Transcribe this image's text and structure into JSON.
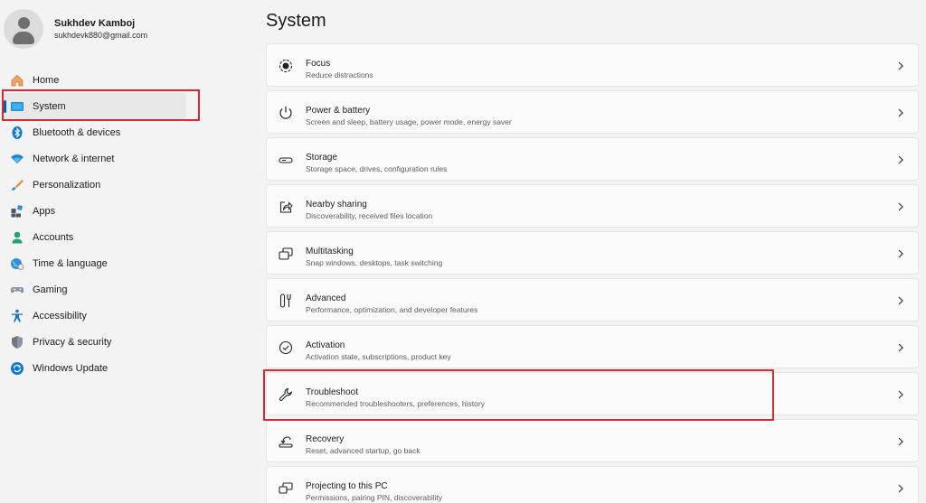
{
  "profile": {
    "name": "Sukhdev Kamboj",
    "email": "sukhdevk880@gmail.com"
  },
  "nav": {
    "items": [
      {
        "label": "Home",
        "icon": "home-icon"
      },
      {
        "label": "System",
        "icon": "system-icon"
      },
      {
        "label": "Bluetooth & devices",
        "icon": "bluetooth-icon"
      },
      {
        "label": "Network & internet",
        "icon": "wifi-icon"
      },
      {
        "label": "Personalization",
        "icon": "brush-icon"
      },
      {
        "label": "Apps",
        "icon": "apps-icon"
      },
      {
        "label": "Accounts",
        "icon": "accounts-icon"
      },
      {
        "label": "Time & language",
        "icon": "globe-clock-icon"
      },
      {
        "label": "Gaming",
        "icon": "gamepad-icon"
      },
      {
        "label": "Accessibility",
        "icon": "accessibility-icon"
      },
      {
        "label": "Privacy & security",
        "icon": "shield-icon"
      },
      {
        "label": "Windows Update",
        "icon": "update-icon"
      }
    ],
    "selected": "System"
  },
  "main": {
    "title": "System",
    "cards": [
      {
        "title": "Focus",
        "subtitle": "Reduce distractions",
        "icon": "focus-icon"
      },
      {
        "title": "Power & battery",
        "subtitle": "Screen and sleep, battery usage, power mode, energy saver",
        "icon": "power-icon"
      },
      {
        "title": "Storage",
        "subtitle": "Storage space, drives, configuration rules",
        "icon": "storage-icon"
      },
      {
        "title": "Nearby sharing",
        "subtitle": "Discoverability, received files location",
        "icon": "share-icon"
      },
      {
        "title": "Multitasking",
        "subtitle": "Snap windows, desktops, task switching",
        "icon": "multitasking-icon"
      },
      {
        "title": "Advanced",
        "subtitle": "Performance, optimization, and developer features",
        "icon": "tools-icon"
      },
      {
        "title": "Activation",
        "subtitle": "Activation state, subscriptions, product key",
        "icon": "check-circle-icon"
      },
      {
        "title": "Troubleshoot",
        "subtitle": "Recommended troubleshooters, preferences, history",
        "icon": "wrench-icon"
      },
      {
        "title": "Recovery",
        "subtitle": "Reset, advanced startup, go back",
        "icon": "recovery-icon"
      },
      {
        "title": "Projecting to this PC",
        "subtitle": "Permissions, pairing PIN, discoverability",
        "icon": "projecting-icon"
      }
    ]
  },
  "colors": {
    "accent": "#005fb8",
    "highlight_red": "#e0262d",
    "background": "#f3f3f3",
    "card": "#fbfbfb"
  }
}
